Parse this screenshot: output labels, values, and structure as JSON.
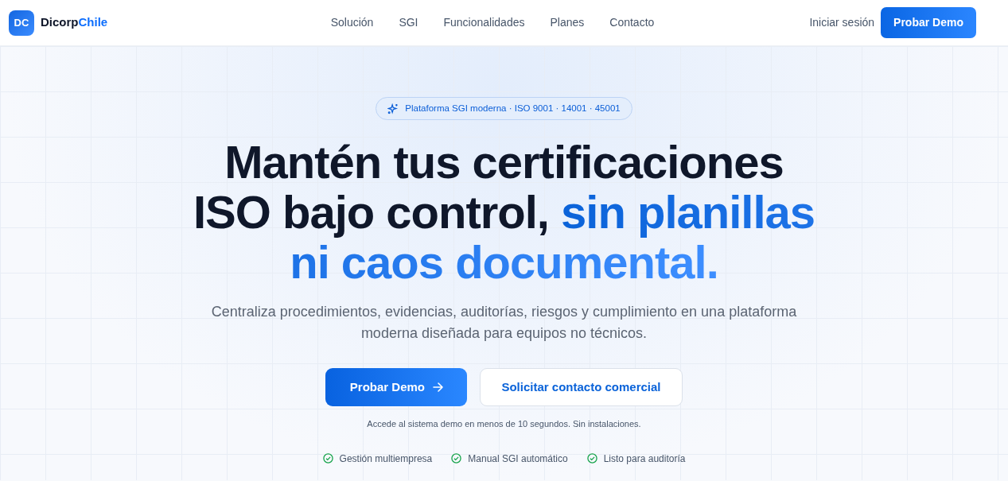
{
  "navbar": {
    "logo_mark": "DC",
    "brand_first": "Dicorp",
    "brand_second": "Chile",
    "links": [
      {
        "label": "Solución"
      },
      {
        "label": "SGI"
      },
      {
        "label": "Funcionalidades"
      },
      {
        "label": "Planes"
      },
      {
        "label": "Contacto"
      }
    ],
    "login": "Iniciar sesión",
    "cta": "Probar Demo"
  },
  "hero": {
    "badge": "Plataforma SGI moderna · ISO 9001 · 14001 · 45001",
    "headline": "Mantén tus certificaciones ISO bajo control, **sin planillas ni caos documental.**",
    "subtitle": "Centraliza procedimientos, evidencias, auditorías, riesgos y cumplimiento en una plataforma moderna diseñada para equipos no técnicos.",
    "primary_button": "Probar Demo",
    "secondary_button": "Solicitar contacto comercial",
    "note": "Accede al sistema demo en menos de 10 segundos. Sin instalaciones.",
    "features": [
      {
        "label": "Gestión multiempresa"
      },
      {
        "label": "Manual SGI automático"
      },
      {
        "label": "Listo para auditoría"
      }
    ]
  }
}
